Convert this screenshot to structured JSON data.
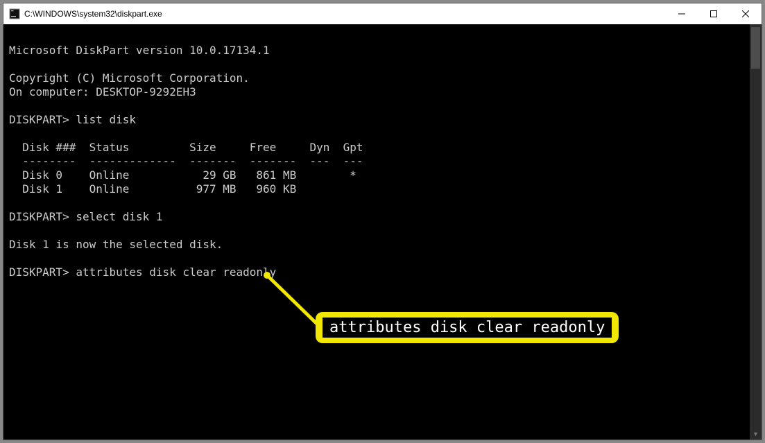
{
  "window": {
    "title": "C:\\WINDOWS\\system32\\diskpart.exe"
  },
  "terminal": {
    "lines": [
      "",
      "Microsoft DiskPart version 10.0.17134.1",
      "",
      "Copyright (C) Microsoft Corporation.",
      "On computer: DESKTOP-9292EH3",
      "",
      "DISKPART> list disk",
      "",
      "  Disk ###  Status         Size     Free     Dyn  Gpt",
      "  --------  -------------  -------  -------  ---  ---",
      "  Disk 0    Online           29 GB   861 MB        *",
      "  Disk 1    Online          977 MB   960 KB",
      "",
      "DISKPART> select disk 1",
      "",
      "Disk 1 is now the selected disk.",
      "",
      "DISKPART> attributes disk clear readonly"
    ]
  },
  "callout": {
    "text": "attributes disk clear readonly"
  }
}
